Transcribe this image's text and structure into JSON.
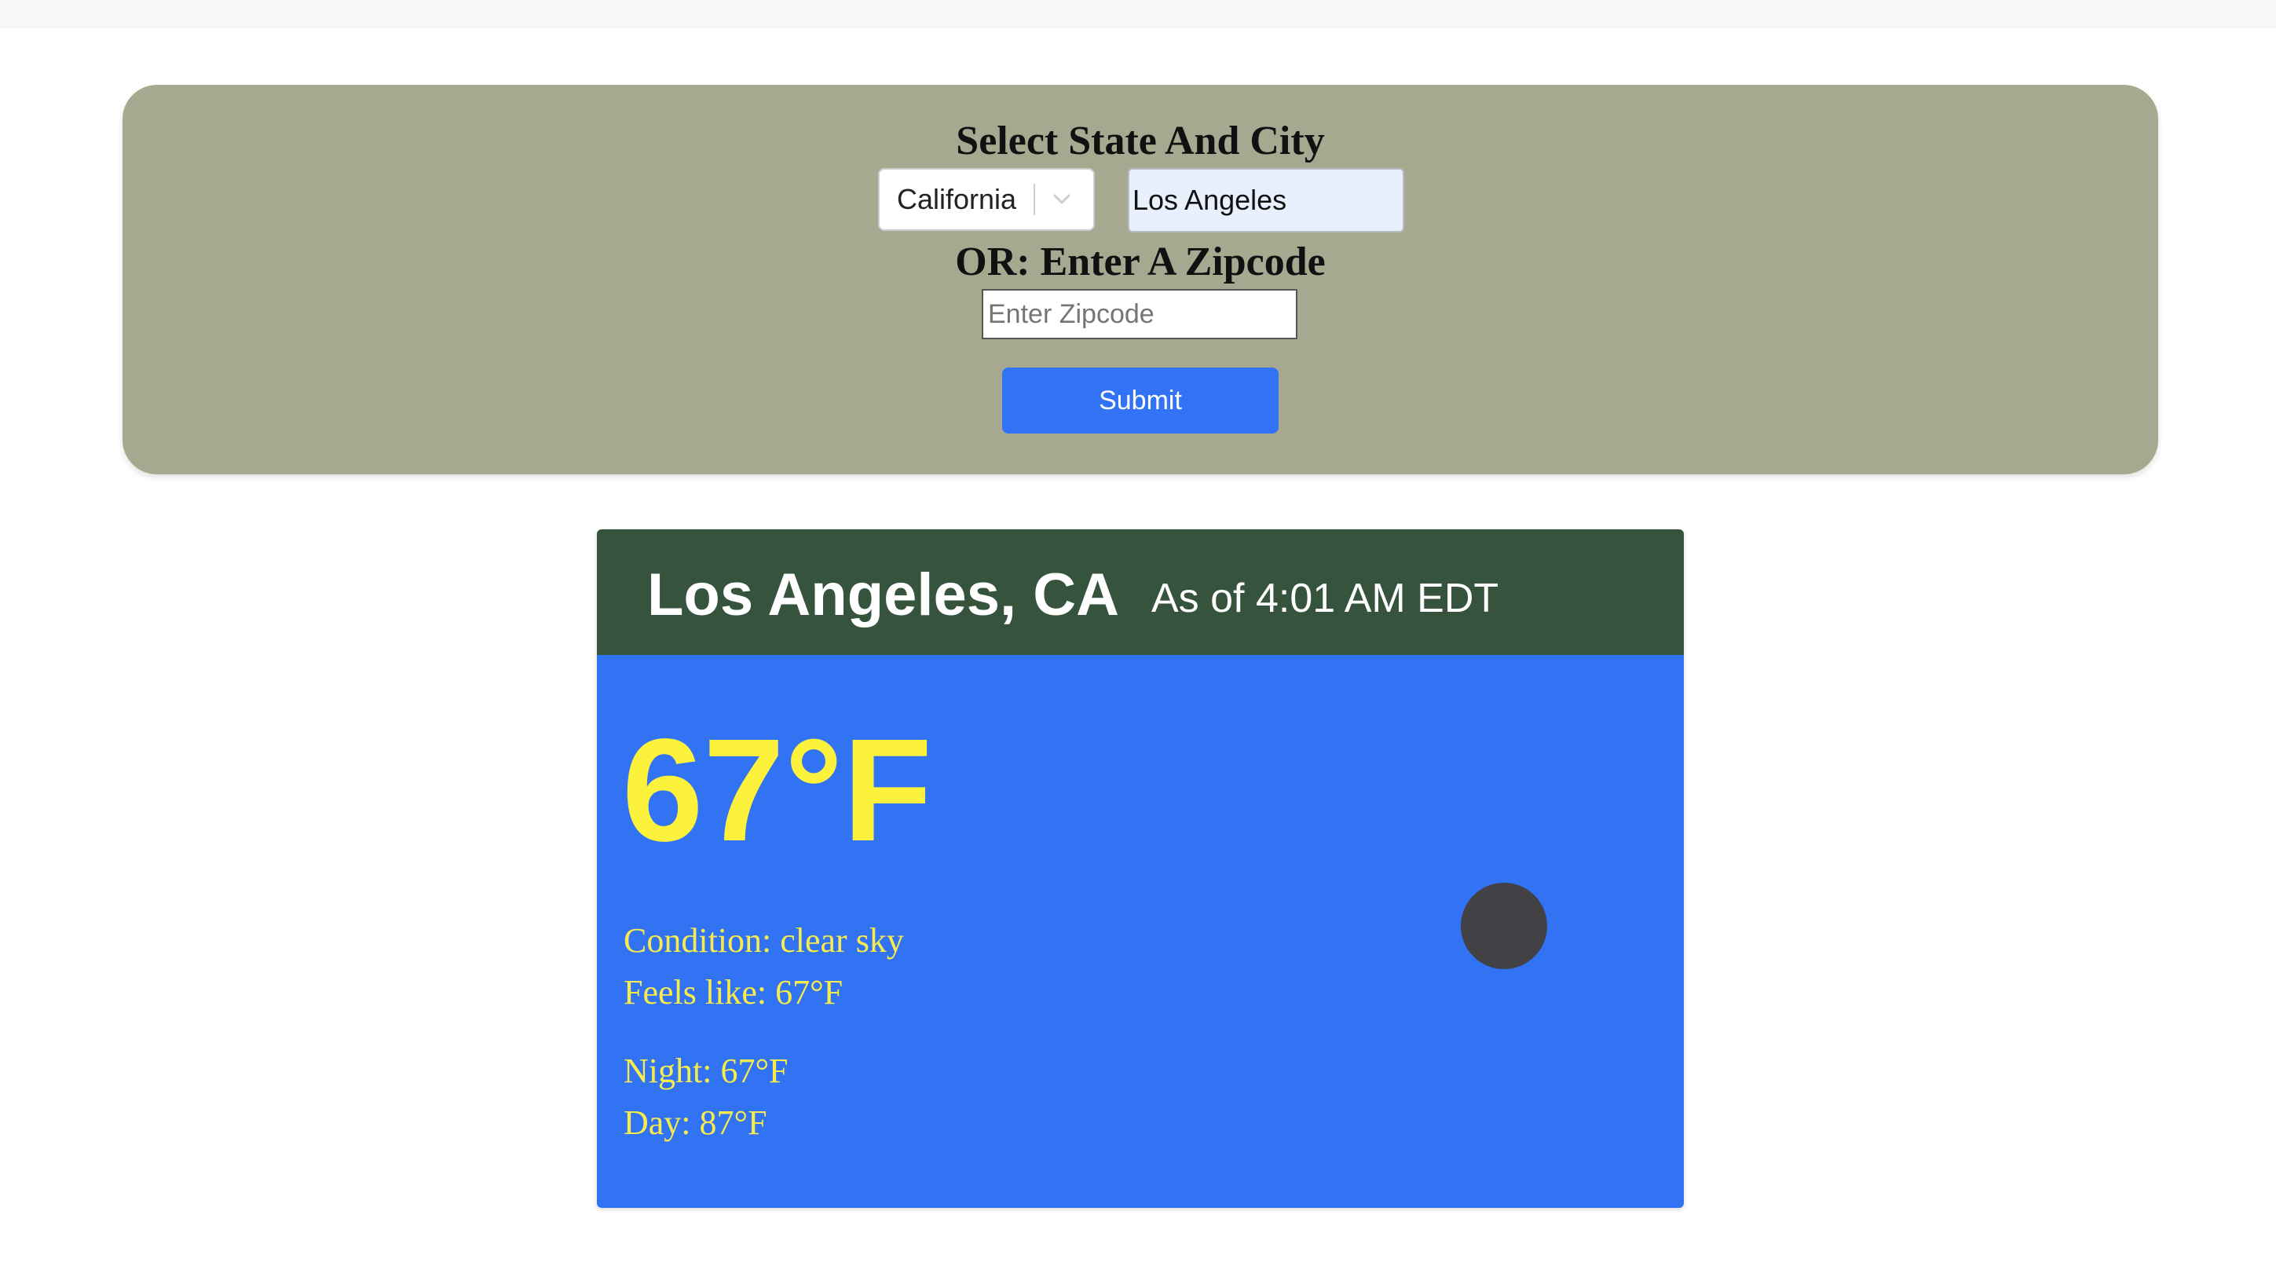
{
  "search": {
    "heading": "Select State And City",
    "state_selected": "California",
    "city_value": "Los Angeles",
    "zip_heading": "OR: Enter A Zipcode",
    "zip_placeholder": "Enter Zipcode",
    "submit_label": "Submit"
  },
  "weather": {
    "location": "Los Angeles, CA",
    "as_of": "As of 4:01 AM EDT",
    "temperature": "67°F",
    "condition": "Condition: clear sky",
    "feels_like": "Feels like: 67°F",
    "night": "Night: 67°F",
    "day": "Day: 87°F",
    "icon": "clear-sky-night-icon"
  },
  "colors": {
    "panel_bg": "#a6a88f",
    "submit_bg": "#3272f5",
    "card_header_bg": "#36533e",
    "card_body_bg": "#3273f4",
    "temp_text": "#fdf23b"
  }
}
